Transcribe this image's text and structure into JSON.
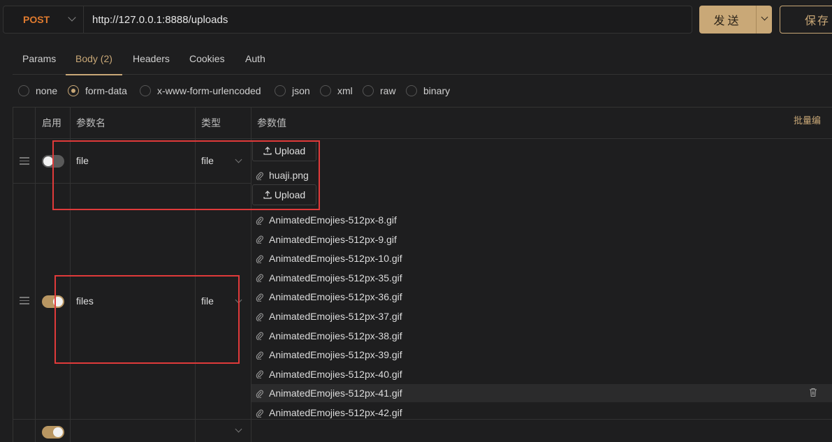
{
  "request": {
    "method": "POST",
    "url": "http://127.0.0.1:8888/uploads"
  },
  "actions": {
    "send": "发送",
    "save": "保存"
  },
  "tabs": [
    "Params",
    "Body (2)",
    "Headers",
    "Cookies",
    "Auth"
  ],
  "body_types": [
    "none",
    "form-data",
    "x-www-form-urlencoded",
    "json",
    "xml",
    "raw",
    "binary"
  ],
  "table": {
    "headers": {
      "enabled": "启用",
      "name": "参数名",
      "type": "类型",
      "value": "参数值"
    },
    "bulk_edit": "批量编",
    "rows": [
      {
        "name": "file",
        "type": "file",
        "upload_label": "Upload",
        "files": [
          "huaji.png"
        ]
      },
      {
        "name": "files",
        "type": "file",
        "upload_label": "Upload",
        "files": [
          "AnimatedEmojies-512px-8.gif",
          "AnimatedEmojies-512px-9.gif",
          "AnimatedEmojies-512px-10.gif",
          "AnimatedEmojies-512px-35.gif",
          "AnimatedEmojies-512px-36.gif",
          "AnimatedEmojies-512px-37.gif",
          "AnimatedEmojies-512px-38.gif",
          "AnimatedEmojies-512px-39.gif",
          "AnimatedEmojies-512px-40.gif",
          "AnimatedEmojies-512px-41.gif",
          "AnimatedEmojies-512px-42.gif"
        ]
      }
    ]
  },
  "colors": {
    "accent": "#c9a877",
    "method": "#e07b2f",
    "highlight_box": "#e03a3a"
  }
}
